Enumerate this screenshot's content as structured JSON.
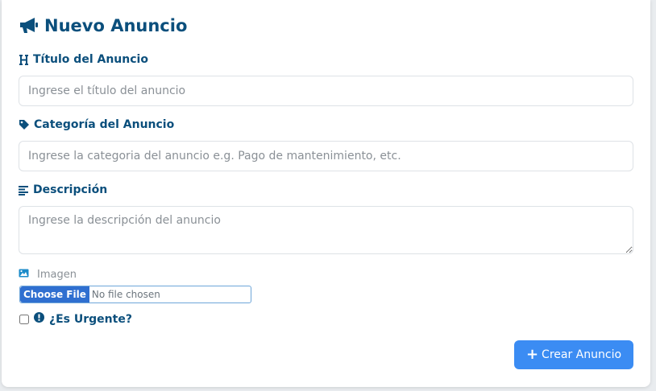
{
  "form": {
    "title": "Nuevo Anuncio",
    "title_field": {
      "label": "Título del Anuncio",
      "placeholder": "Ingrese el título del anuncio"
    },
    "category_field": {
      "label": "Categoría del Anuncio",
      "placeholder": "Ingrese la categoria del anuncio e.g. Pago de mantenimiento, etc."
    },
    "description_field": {
      "label": "Descripción",
      "placeholder": "Ingrese la descripción del anuncio"
    },
    "image_field": {
      "label": "Imagen",
      "button_label": "Choose File",
      "status": "No file chosen"
    },
    "urgent_field": {
      "label": "¿Es Urgente?",
      "checked": false
    },
    "submit_label": "Crear Anuncio"
  },
  "icons": {
    "title": "megaphone-icon",
    "heading": "heading-icon",
    "tag": "tag-icon",
    "description": "align-left-icon",
    "image": "image-icon",
    "urgent": "exclamation-circle-icon",
    "submit": "plus-icon"
  },
  "colors": {
    "heading_text": "#0b4f7c",
    "primary_button": "#3b8cf3",
    "file_button": "#2f6fd0",
    "muted_text": "#8a9096"
  }
}
